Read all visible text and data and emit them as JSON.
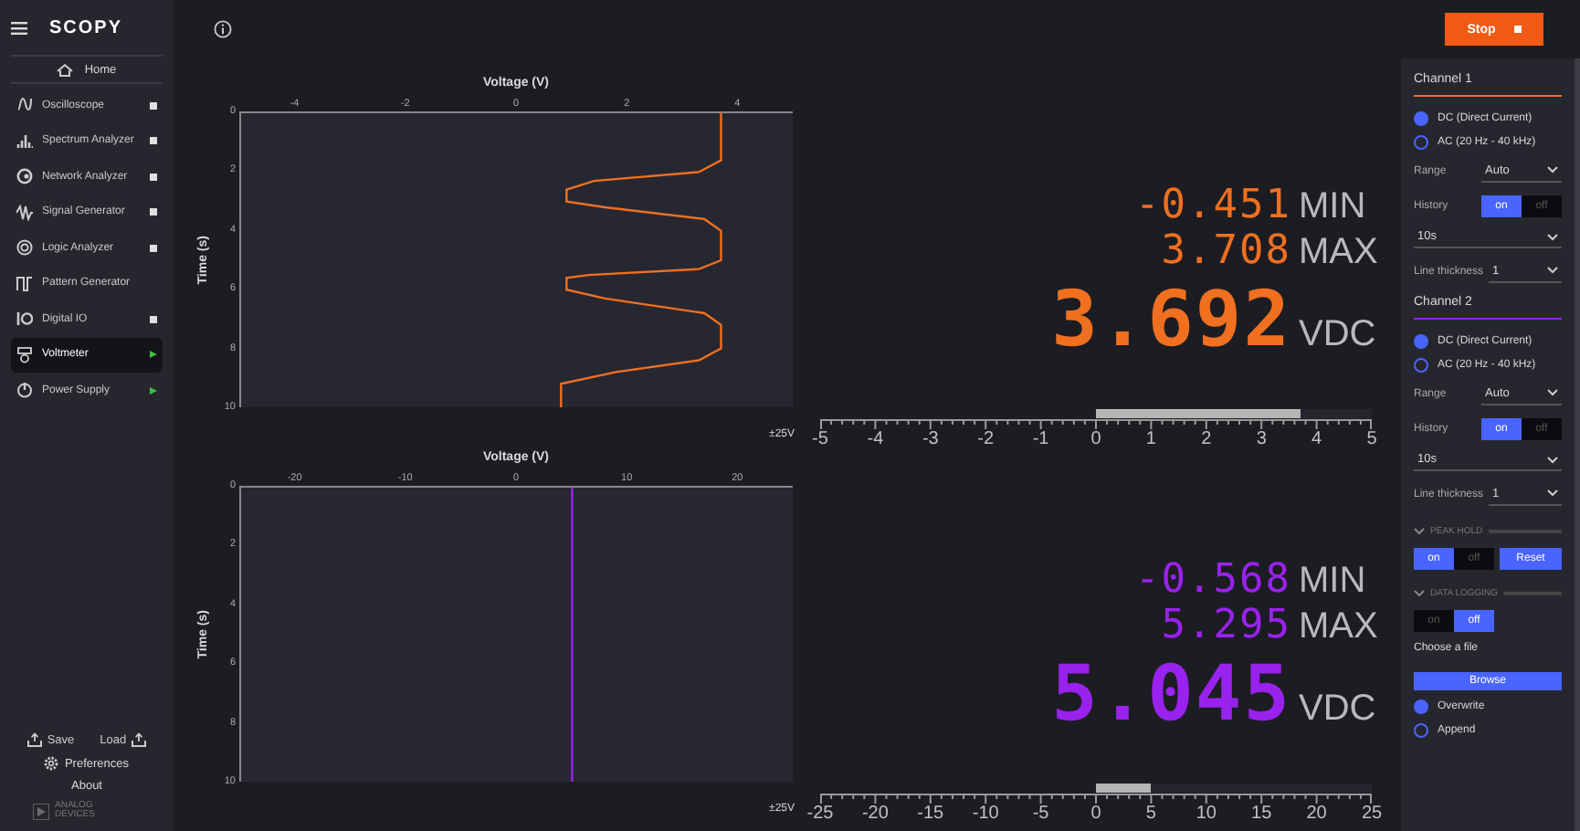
{
  "topbar": {
    "logo": "SCOPY",
    "stop_button": "Stop"
  },
  "sidebar": {
    "home": "Home",
    "items": [
      {
        "label": "Oscilloscope",
        "kind": "stopped",
        "selected": false
      },
      {
        "label": "Spectrum Analyzer",
        "kind": "stopped",
        "selected": false
      },
      {
        "label": "Network Analyzer",
        "kind": "stopped",
        "selected": false
      },
      {
        "label": "Signal Generator",
        "kind": "stopped",
        "selected": false
      },
      {
        "label": "Logic Analyzer",
        "kind": "stopped",
        "selected": false
      },
      {
        "label": "Pattern Generator",
        "kind": "none",
        "selected": false
      },
      {
        "label": "Digital IO",
        "kind": "stopped",
        "selected": false
      },
      {
        "label": "Voltmeter",
        "kind": "running",
        "selected": true
      },
      {
        "label": "Power Supply",
        "kind": "running",
        "selected": false
      }
    ],
    "save": "Save",
    "load": "Load",
    "preferences": "Preferences",
    "about": "About",
    "vendor_logo": [
      "ANALOG",
      "DEVICES"
    ]
  },
  "channels": [
    {
      "color": "#f07020",
      "plot": {
        "title": "Voltage (V)",
        "ylabel": "Time (s)",
        "xticks": [
          "-4",
          "-2",
          "0",
          "2",
          "4"
        ],
        "yticks": [
          "0",
          "2",
          "4",
          "6",
          "8",
          "10"
        ]
      },
      "min": "-0.451",
      "min_label": "MIN",
      "max": "3.708",
      "max_label": "MAX",
      "value": "3.692",
      "unit": "VDC",
      "range_label": "±25V",
      "scale": {
        "ticks": [
          "-5",
          "-4",
          "-3",
          "-2",
          "-1",
          "0",
          "1",
          "2",
          "3",
          "4",
          "5"
        ],
        "level": 0.74
      }
    },
    {
      "color": "#9a22ee",
      "plot": {
        "title": "Voltage (V)",
        "ylabel": "Time (s)",
        "xticks": [
          "-20",
          "-10",
          "0",
          "10",
          "20"
        ],
        "yticks": [
          "0",
          "2",
          "4",
          "6",
          "8",
          "10"
        ]
      },
      "min": "-0.568",
      "min_label": "MIN",
      "max": "5.295",
      "max_label": "MAX",
      "value": "5.045",
      "unit": "VDC",
      "range_label": "±25V",
      "scale": {
        "ticks": [
          "-25",
          "-20",
          "-15",
          "-10",
          "-5",
          "0",
          "5",
          "10",
          "15",
          "20",
          "25"
        ],
        "level": 0.2
      }
    }
  ],
  "settings": {
    "channels": [
      {
        "title": "Channel 1",
        "coupling": [
          {
            "label": "DC (Direct Current)",
            "selected": true
          },
          {
            "label": "AC (20 Hz - 40 kHz)",
            "selected": false
          }
        ],
        "range": {
          "label": "Range",
          "value": "Auto"
        },
        "history": {
          "label": "History",
          "options": [
            {
              "label": "on",
              "selected": true
            },
            {
              "label": "off",
              "selected": false
            }
          ],
          "duration": "10s"
        },
        "line_thickness": {
          "label": "Line thickness",
          "value": "1"
        }
      },
      {
        "title": "Channel 2",
        "coupling": [
          {
            "label": "DC (Direct Current)",
            "selected": true
          },
          {
            "label": "AC (20 Hz - 40 kHz)",
            "selected": false
          }
        ],
        "range": {
          "label": "Range",
          "value": "Auto"
        },
        "history": {
          "label": "History",
          "options": [
            {
              "label": "on",
              "selected": true
            },
            {
              "label": "off",
              "selected": false
            }
          ],
          "duration": "10s"
        },
        "line_thickness": {
          "label": "Line thickness",
          "value": "1"
        }
      }
    ],
    "peak_hold": {
      "title": "PEAK HOLD",
      "options": [
        {
          "label": "on",
          "selected": true
        },
        {
          "label": "off",
          "selected": false
        }
      ],
      "reset": "Reset"
    },
    "data_logging": {
      "title": "DATA LOGGING",
      "options": [
        {
          "label": "on",
          "selected": false
        },
        {
          "label": "off",
          "selected": true
        }
      ],
      "choose_file": "Choose a file",
      "browse": "Browse",
      "modes": [
        {
          "label": "Overwrite",
          "selected": true
        },
        {
          "label": "Append",
          "selected": false
        }
      ]
    }
  }
}
